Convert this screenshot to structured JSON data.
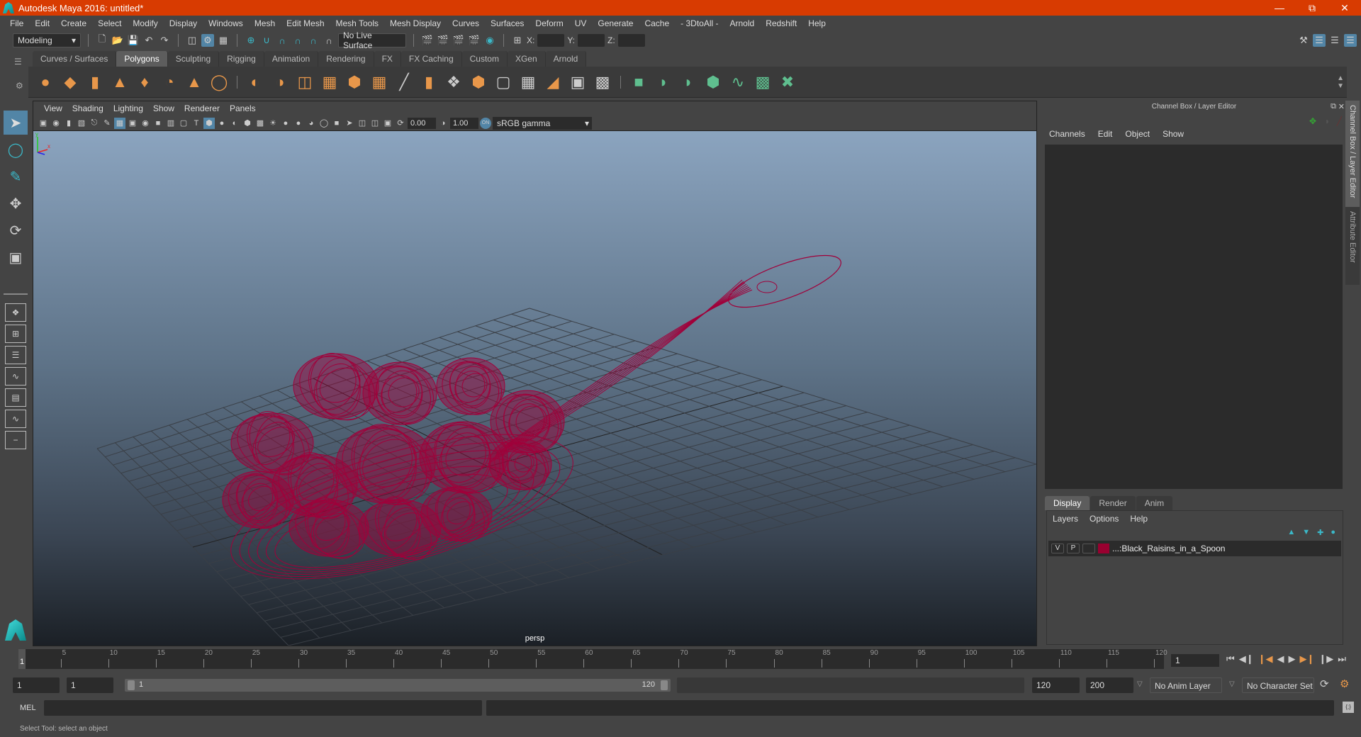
{
  "window": {
    "title": "Autodesk Maya 2016: untitled*",
    "controls": [
      "minimize",
      "restore",
      "close"
    ]
  },
  "menubar": [
    "File",
    "Edit",
    "Create",
    "Select",
    "Modify",
    "Display",
    "Windows",
    "Mesh",
    "Edit Mesh",
    "Mesh Tools",
    "Mesh Display",
    "Curves",
    "Surfaces",
    "Deform",
    "UV",
    "Generate",
    "Cache",
    "- 3DtoAll -",
    "Arnold",
    "Redshift",
    "Help"
  ],
  "statusline": {
    "mode": "Modeling",
    "live_surface": "No Live Surface",
    "x_label": "X:",
    "y_label": "Y:",
    "z_label": "Z:"
  },
  "shelf_tabs": [
    {
      "label": "Curves / Surfaces",
      "selected": false
    },
    {
      "label": "Polygons",
      "selected": true
    },
    {
      "label": "Sculpting",
      "selected": false
    },
    {
      "label": "Rigging",
      "selected": false
    },
    {
      "label": "Animation",
      "selected": false
    },
    {
      "label": "Rendering",
      "selected": false
    },
    {
      "label": "FX",
      "selected": false
    },
    {
      "label": "FX Caching",
      "selected": false
    },
    {
      "label": "Custom",
      "selected": false
    },
    {
      "label": "XGen",
      "selected": false
    },
    {
      "label": "Arnold",
      "selected": false
    }
  ],
  "viewport": {
    "menu": [
      "View",
      "Shading",
      "Lighting",
      "Show",
      "Renderer",
      "Panels"
    ],
    "exposure": "0.00",
    "gamma": "1.00",
    "color_space": "sRGB gamma",
    "camera_label": "persp",
    "wire_color": "#a0003a"
  },
  "channel_box": {
    "title": "Channel Box / Layer Editor",
    "menu": [
      "Channels",
      "Edit",
      "Object",
      "Show"
    ],
    "layer_tabs": [
      {
        "label": "Display",
        "selected": true
      },
      {
        "label": "Render",
        "selected": false
      },
      {
        "label": "Anim",
        "selected": false
      }
    ],
    "layer_menu": [
      "Layers",
      "Options",
      "Help"
    ],
    "layers": [
      {
        "v": "V",
        "p": "P",
        "color": "#990030",
        "name": "...:Black_Raisins_in_a_Spoon"
      }
    ]
  },
  "side_tabs": [
    "Channel Box / Layer Editor",
    "Attribute Editor"
  ],
  "timeline": {
    "ticks": [
      "5",
      "10",
      "15",
      "20",
      "25",
      "30",
      "35",
      "40",
      "45",
      "50",
      "55",
      "60",
      "65",
      "70",
      "75",
      "80",
      "85",
      "90",
      "95",
      "100",
      "105",
      "110",
      "115",
      "120"
    ],
    "current_frame_marker": "1",
    "current_frame": "1"
  },
  "range": {
    "start": "1",
    "playback_start": "1",
    "slider_start": "1",
    "slider_end": "120",
    "playback_end": "120",
    "end": "200",
    "anim_layer": "No Anim Layer",
    "character_set": "No Character Set"
  },
  "command_line": {
    "label": "MEL",
    "value": ""
  },
  "help_line": "Select Tool: select an object"
}
